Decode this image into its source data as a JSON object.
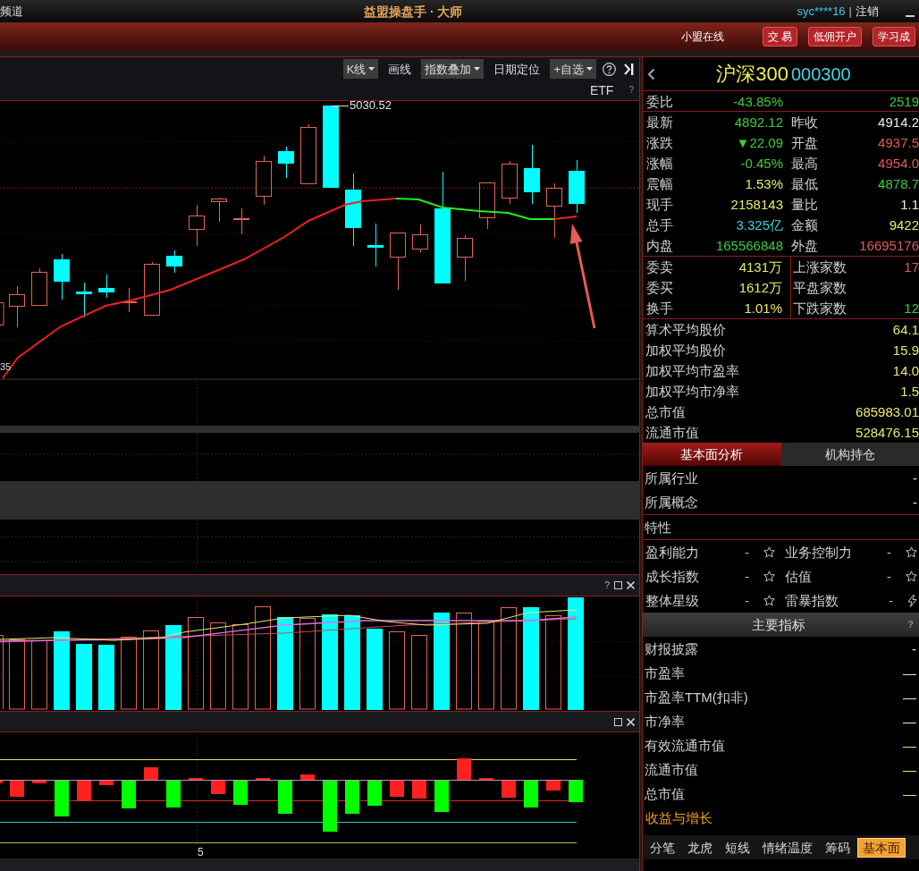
{
  "title_bar": {
    "channel": "频道",
    "title": "益盟操盘手 · 大师",
    "user": "syc****16",
    "divider": "|",
    "logout": "注销"
  },
  "header_bar": {
    "status": "小盟在线",
    "buttons": [
      {
        "label": "交 易"
      },
      {
        "label": "低佣开户"
      },
      {
        "label": "学习成"
      }
    ]
  },
  "chart_toolbar": [
    {
      "label": "K线",
      "dropdown": true
    },
    {
      "label": "画线",
      "dropdown": false
    },
    {
      "label": "指数叠加",
      "dropdown": true
    },
    {
      "label": "日期定位",
      "dropdown": false
    },
    {
      "label": "+自选",
      "dropdown": true
    }
  ],
  "price_chart": {
    "overlay": "ETF",
    "help": "?",
    "high_label": "5030.52",
    "low_label": "35"
  },
  "volume_panel": {
    "help": "?"
  },
  "time_axis": {
    "label": "5"
  },
  "quote": {
    "name": "沪深300",
    "code": "000300"
  },
  "order_ratio": {
    "label": "委比",
    "value": "-43.85%",
    "amount": "2519",
    "color": "#3ccc3c"
  },
  "quote_grid": [
    {
      "label": "最新",
      "value": "4892.12",
      "color": "#3ccc3c"
    },
    {
      "label": "昨收",
      "value": "4914.2",
      "color": "#e8e8e8"
    },
    {
      "label": "涨跌",
      "value": "▼22.09",
      "color": "#3ccc3c"
    },
    {
      "label": "开盘",
      "value": "4937.5",
      "color": "#e05a5a"
    },
    {
      "label": "涨幅",
      "value": "-0.45%",
      "color": "#3ccc3c"
    },
    {
      "label": "最高",
      "value": "4954.0",
      "color": "#e05a5a"
    },
    {
      "label": "震幅",
      "value": "1.53%",
      "color": "#e8e86a"
    },
    {
      "label": "最低",
      "value": "4878.7",
      "color": "#3ccc3c"
    },
    {
      "label": "现手",
      "value": "2158143",
      "color": "#e8e86a"
    },
    {
      "label": "量比",
      "value": "1.1",
      "color": "#e8e8e8"
    },
    {
      "label": "总手",
      "value": "3.325亿",
      "color": "#40d0d8"
    },
    {
      "label": "金额",
      "value": "9422",
      "color": "#e8e86a"
    },
    {
      "label": "内盘",
      "value": "165566848",
      "color": "#3ccc3c"
    },
    {
      "label": "外盘",
      "value": "16695176",
      "color": "#e05a5a"
    }
  ],
  "order_book": [
    {
      "label": "委卖",
      "value": "4131万",
      "color": "#e8e86a"
    },
    {
      "label": "上涨家数",
      "value": "17",
      "color": "#e05a5a"
    },
    {
      "label": "委买",
      "value": "1612万",
      "color": "#e8e86a"
    },
    {
      "label": "平盘家数"
    },
    {
      "label": "换手",
      "value": "1.01%",
      "color": "#e8e86a"
    },
    {
      "label": "下跌家数",
      "value": "12",
      "color": "#3ccc3c"
    }
  ],
  "market_stats": [
    {
      "label": "算术平均股价",
      "value": "64.1"
    },
    {
      "label": "加权平均股价",
      "value": "15.9"
    },
    {
      "label": "加权平均市盈率",
      "value": "14.0"
    },
    {
      "label": "加权平均市净率",
      "value": "1.5"
    },
    {
      "label": "总市值",
      "value": "685983.01"
    },
    {
      "label": "流通市值",
      "value": "528476.15"
    }
  ],
  "info_tabs": [
    {
      "label": "基本面分析",
      "selected": true
    },
    {
      "label": "机构持仓",
      "selected": false
    }
  ],
  "classification": [
    {
      "label": "所属行业",
      "value": "-"
    },
    {
      "label": "所属概念",
      "value": "-"
    }
  ],
  "traits": {
    "title": "特性",
    "items": [
      {
        "label": "盈利能力",
        "value": "-",
        "kind": "star"
      },
      {
        "label": "业务控制力",
        "value": "-",
        "kind": "star"
      },
      {
        "label": "成长指数",
        "value": "-",
        "kind": "star"
      },
      {
        "label": "估值",
        "value": "-",
        "kind": "star"
      },
      {
        "label": "整体星级",
        "value": "-",
        "kind": "star"
      },
      {
        "label": "雷暴指数",
        "value": "-",
        "kind": "bolt"
      }
    ]
  },
  "key_metrics": {
    "title": "主要指标",
    "help": "?",
    "rows": [
      {
        "label": "财报披露",
        "value": "-",
        "color": "#e8e8e8"
      },
      {
        "label": "市盈率",
        "value": "—",
        "color": "#e8e8e8"
      },
      {
        "label": "市盈率TTM(扣非)",
        "value": "—",
        "color": "#e8e8e8"
      },
      {
        "label": "市净率",
        "value": "—",
        "color": "#e8e8e8"
      },
      {
        "label": "有效流通市值",
        "value": "—",
        "color": "#e8e86a"
      },
      {
        "label": "流通市值",
        "value": "—",
        "color": "#e8e86a"
      },
      {
        "label": "总市值",
        "value": "—",
        "color": "#e8e86a"
      }
    ]
  },
  "section_link": {
    "label": "收益与增长"
  },
  "bottom_tabs": [
    {
      "label": "分笔",
      "selected": false
    },
    {
      "label": "龙虎",
      "selected": false
    },
    {
      "label": "短线",
      "selected": false
    },
    {
      "label": "情绪温度",
      "selected": false
    },
    {
      "label": "筹码",
      "selected": false
    },
    {
      "label": "基本面",
      "selected": true
    }
  ]
}
